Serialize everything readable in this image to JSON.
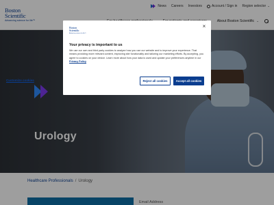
{
  "brand": {
    "logo_line1": "Boston",
    "logo_line2": "Scientific",
    "tagline": "Advancing science for life™"
  },
  "utility_nav": {
    "news": "News",
    "careers": "Careers",
    "investors": "Investors",
    "account": "Account / Sign in",
    "region": "Region selector"
  },
  "main_nav": {
    "item1": "For healthcare professionals",
    "item2": "For patients and caregivers",
    "item3": "About Boston Scientific"
  },
  "hero": {
    "title": "Urology"
  },
  "breadcrumb": {
    "parent": "Healthcare Professionals",
    "separator": "/",
    "current": "Urology"
  },
  "form": {
    "email_label": "Email Address"
  },
  "cookie_dialog": {
    "title": "Your privacy is important to us",
    "body_text": "We use our own and third party cookies to analyze how you use our website and to improve your experience. That means providing more relevant content, improving site functionality and tailoring our marketing efforts. By accepting, you agree to cookies on your device. Learn more about how your data is used and update your preferences anytime in our ",
    "policy_link": "Privacy Policy",
    "customize_label": "Customize cookies",
    "reject_label": "Reject all cookies",
    "accept_label": "Accept all cookies",
    "close_glyph": "×"
  },
  "colors": {
    "brand_blue": "#0a3d8f",
    "accent_blue": "#2f8cff",
    "accent_purple": "#7c3aed",
    "panel_blue": "#0d6ea5"
  },
  "icons": [
    "news-chevron-icon",
    "person-icon",
    "chevron-down-icon",
    "search-icon",
    "close-icon"
  ]
}
